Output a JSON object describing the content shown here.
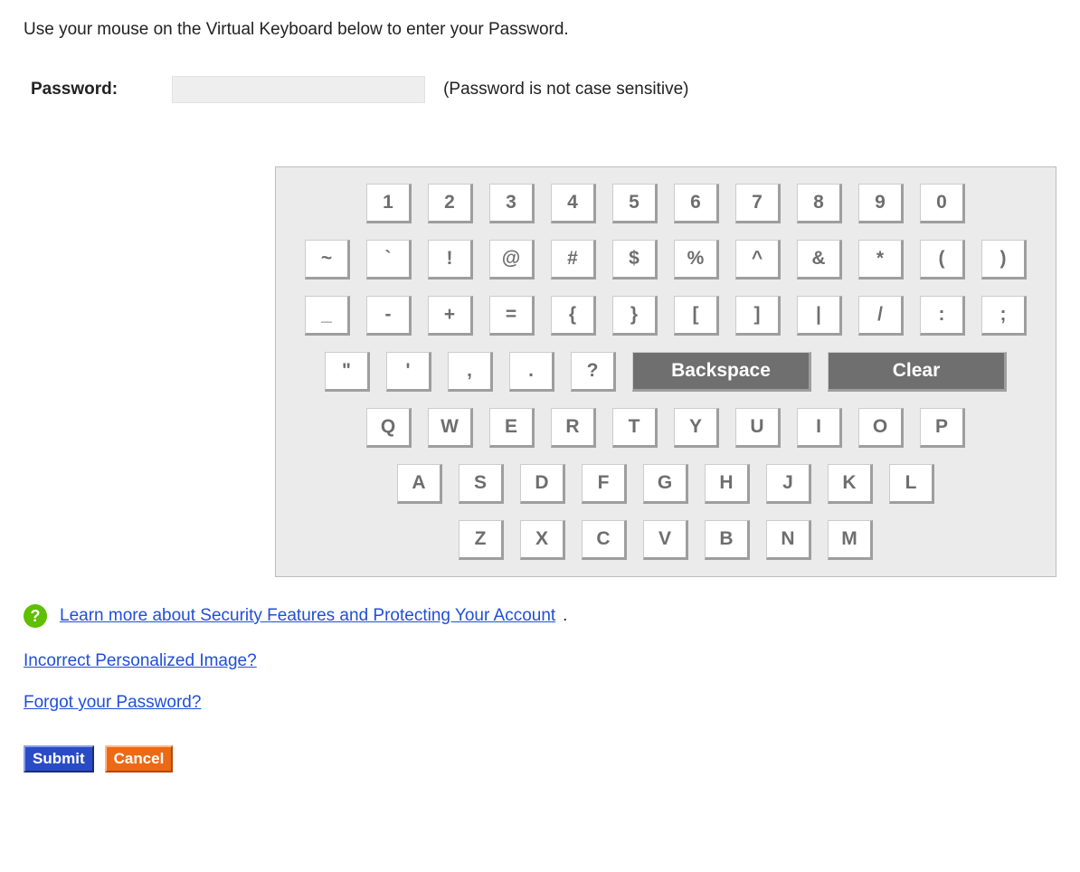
{
  "instruction": "Use your mouse on the Virtual Keyboard below to enter your Password.",
  "password": {
    "label": "Password:",
    "value": "",
    "note": "(Password is not case sensitive)"
  },
  "keyboard": {
    "row1": [
      "1",
      "2",
      "3",
      "4",
      "5",
      "6",
      "7",
      "8",
      "9",
      "0"
    ],
    "row2": [
      "~",
      "`",
      "!",
      "@",
      "#",
      "$",
      "%",
      "^",
      "&",
      "*",
      "(",
      ")"
    ],
    "row3": [
      "_",
      "-",
      "+",
      "=",
      "{",
      "}",
      "[",
      "]",
      "|",
      "/",
      ":",
      ";"
    ],
    "row4": [
      "\"",
      "'",
      ",",
      ".",
      "?"
    ],
    "backspace": "Backspace",
    "clear": "Clear",
    "row5": [
      "Q",
      "W",
      "E",
      "R",
      "T",
      "Y",
      "U",
      "I",
      "O",
      "P"
    ],
    "row6": [
      "A",
      "S",
      "D",
      "F",
      "G",
      "H",
      "J",
      "K",
      "L"
    ],
    "row7": [
      "Z",
      "X",
      "C",
      "V",
      "B",
      "N",
      "M"
    ]
  },
  "helpLink": "Learn more about Security Features and Protecting Your Account",
  "links": {
    "incorrectImage": "Incorrect Personalized Image?",
    "forgotPassword": "Forgot your Password?"
  },
  "buttons": {
    "submit": "Submit",
    "cancel": "Cancel"
  }
}
